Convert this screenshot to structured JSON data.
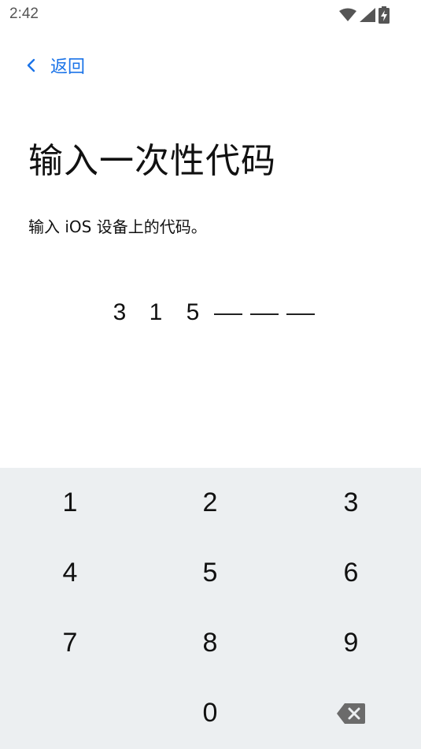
{
  "status_bar": {
    "time": "2:42",
    "icons": [
      "wifi-icon",
      "cell-signal-icon",
      "battery-charging-icon"
    ]
  },
  "nav": {
    "back_label": "返回",
    "accent_color": "#1a73e8"
  },
  "page": {
    "title": "输入一次性代码",
    "subtitle": "输入 iOS 设备上的代码。"
  },
  "code": {
    "entered": [
      "3",
      "1",
      "5"
    ],
    "remaining_slots": 3
  },
  "keypad": {
    "keys": [
      "1",
      "2",
      "3",
      "4",
      "5",
      "6",
      "7",
      "8",
      "9",
      "0"
    ],
    "delete_icon": "backspace-icon",
    "background": "#eceff1"
  }
}
